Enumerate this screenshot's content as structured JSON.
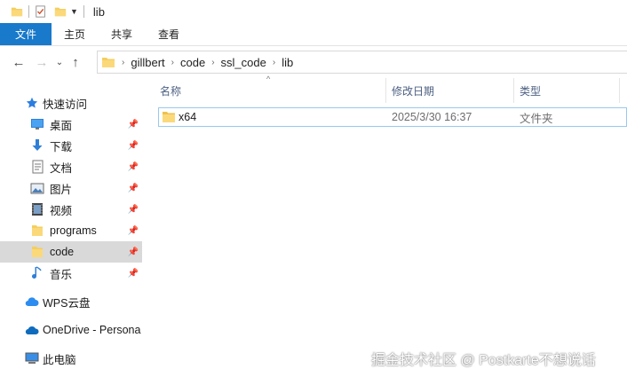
{
  "window": {
    "title": "lib"
  },
  "ribbon": {
    "tabs": [
      {
        "label": "文件",
        "active": true
      },
      {
        "label": "主页"
      },
      {
        "label": "共享"
      },
      {
        "label": "查看"
      }
    ],
    "accent_color": "#1979ca"
  },
  "address": {
    "breadcrumbs": [
      "gillbert",
      "code",
      "ssl_code",
      "lib"
    ]
  },
  "nav": {
    "quick_access_label": "快速访问",
    "items": [
      {
        "label": "桌面",
        "icon": "desktop-icon",
        "pinned": true
      },
      {
        "label": "下载",
        "icon": "download-icon",
        "pinned": true
      },
      {
        "label": "文档",
        "icon": "document-icon",
        "pinned": true
      },
      {
        "label": "图片",
        "icon": "picture-icon",
        "pinned": true
      },
      {
        "label": "视频",
        "icon": "video-icon",
        "pinned": true
      },
      {
        "label": "programs",
        "icon": "folder-icon",
        "pinned": true
      },
      {
        "label": "code",
        "icon": "folder-icon",
        "pinned": true,
        "selected": true
      },
      {
        "label": "音乐",
        "icon": "music-icon",
        "pinned": true
      }
    ],
    "wps_label": "WPS云盘",
    "onedrive_label": "OneDrive - Persona",
    "thispc_label": "此电脑"
  },
  "columns": {
    "name": "名称",
    "modified": "修改日期",
    "type": "类型"
  },
  "files": [
    {
      "name": "x64",
      "modified": "2025/3/30 16:37",
      "type": "文件夹"
    }
  ],
  "watermark": "掘金技术社区 @ Postkarte不想说话"
}
